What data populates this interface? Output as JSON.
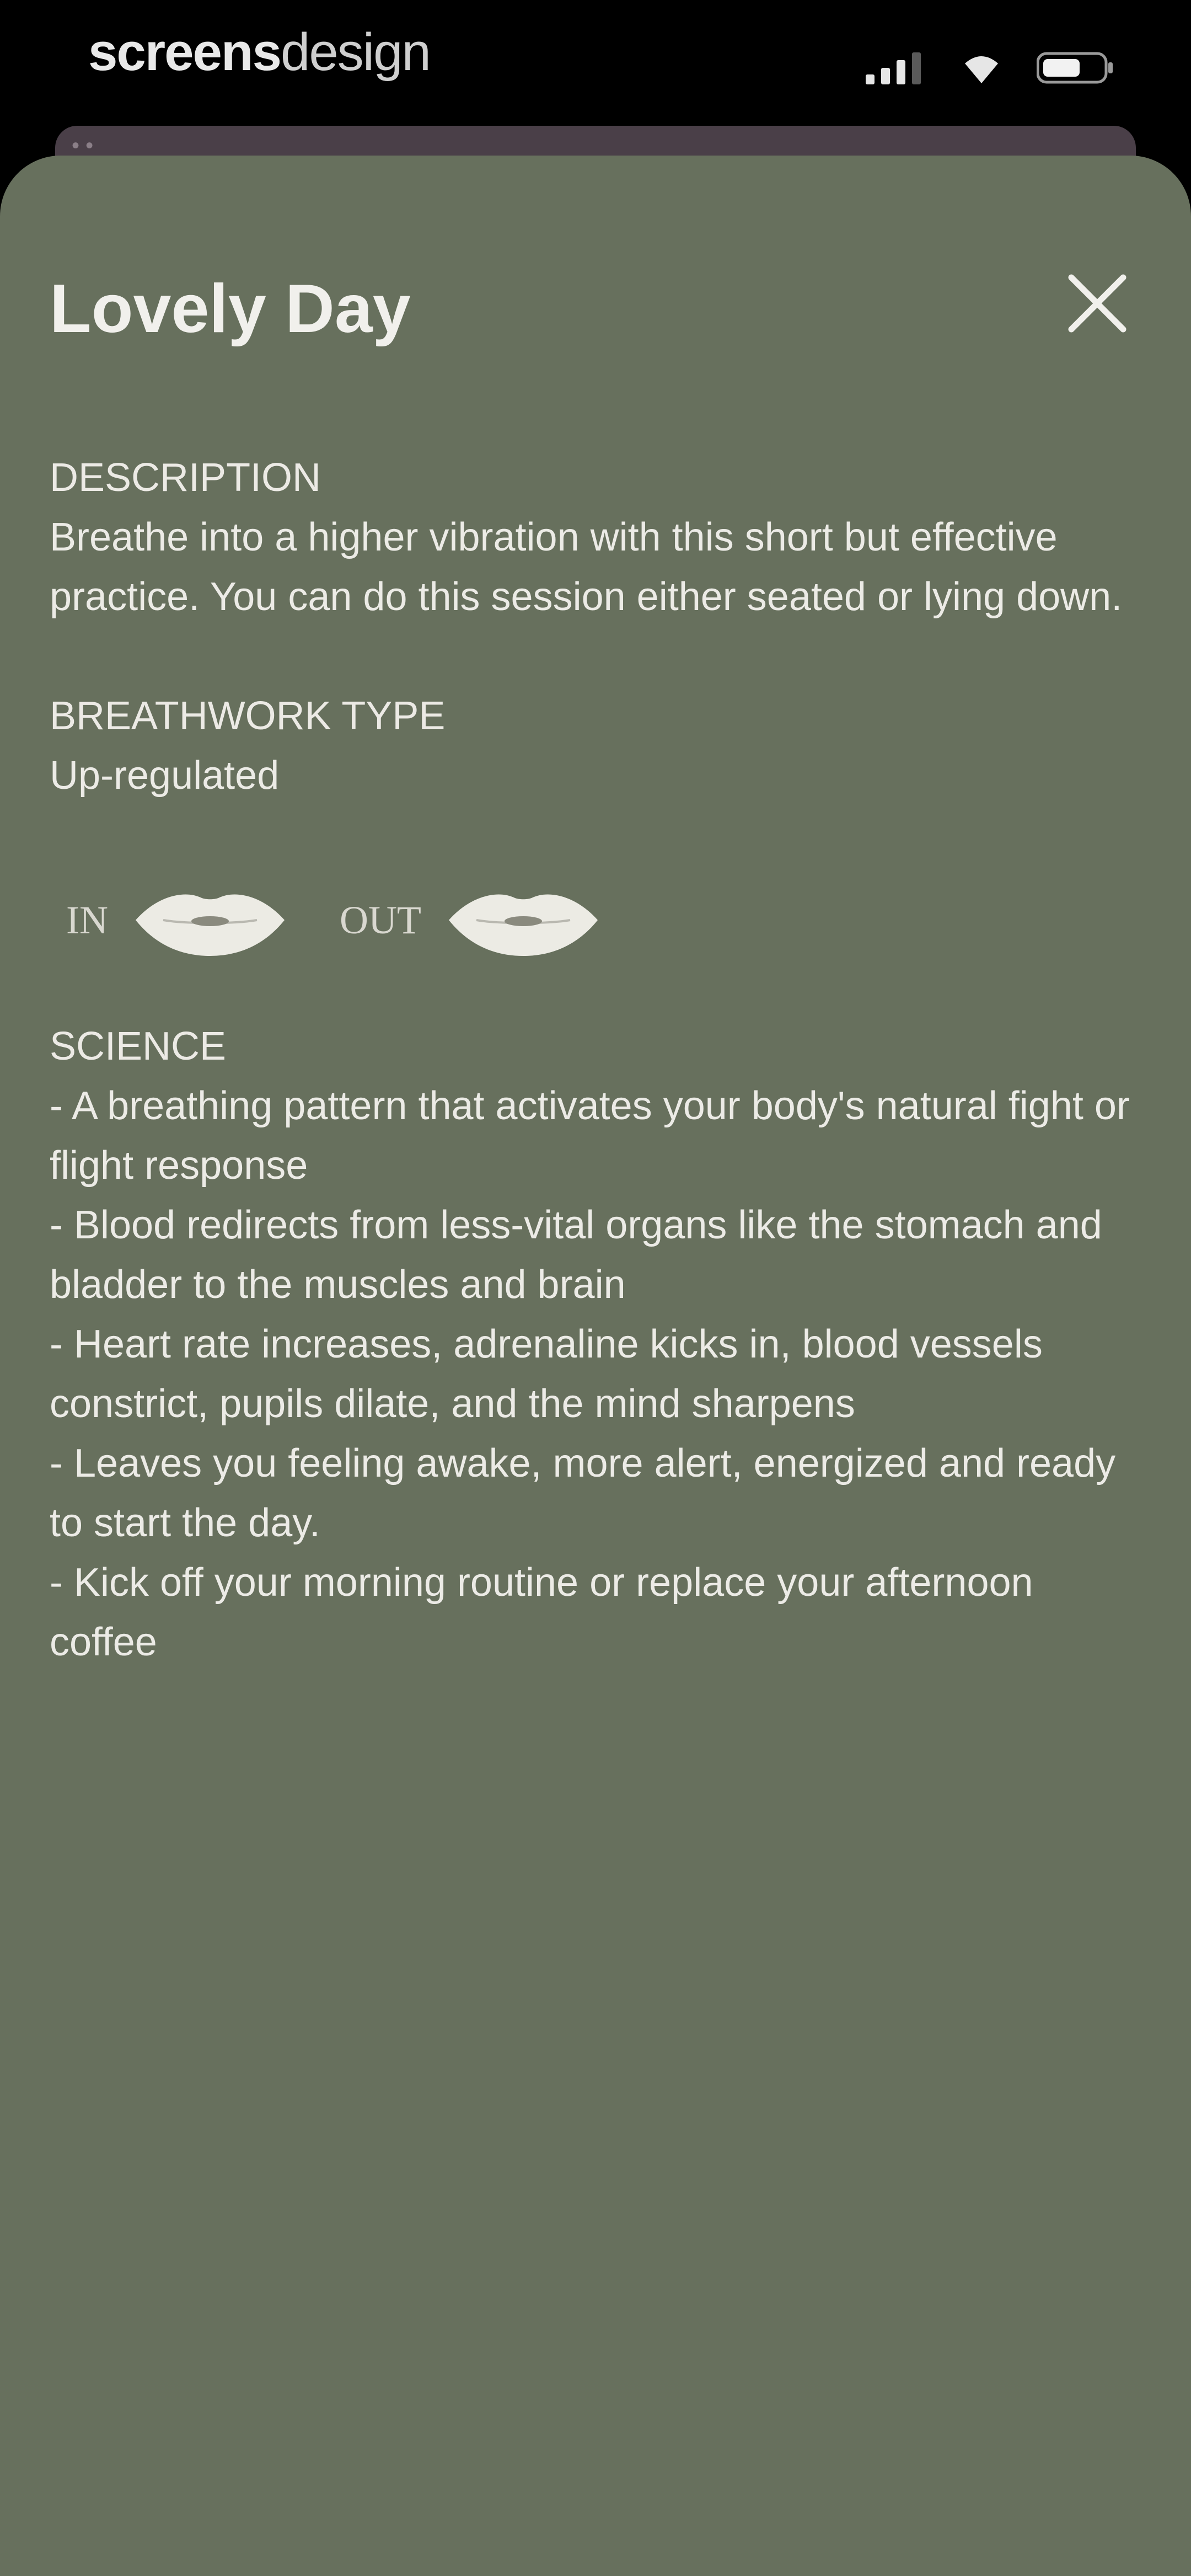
{
  "status_bar": {
    "brand_bold": "screens",
    "brand_light": "design",
    "icons": [
      "signal-icon",
      "wifi-icon",
      "battery-icon"
    ]
  },
  "sheet": {
    "title": "Lovely Day",
    "close_icon": "close-icon",
    "description": {
      "label": "DESCRIPTION",
      "text": "Breathe into a higher vibration with this short but effective practice. You can do this session either seated or lying down."
    },
    "breathwork": {
      "label": "BREATHWORK TYPE",
      "value": "Up-regulated"
    },
    "breath_pattern": {
      "in_label": "IN",
      "in_icon": "mouth-icon",
      "out_label": "OUT",
      "out_icon": "mouth-icon"
    },
    "science": {
      "label": "SCIENCE",
      "items": [
        "- A breathing pattern that activates your body's natural fight or flight response",
        "- Blood redirects from less-vital organs like the stomach and bladder to the muscles and brain",
        "- Heart rate increases, adrenaline kicks in, blood vessels constrict, pupils dilate, and the mind sharpens",
        "- Leaves you feeling awake, more alert, energized and ready to start the day.",
        "- Kick off your morning routine or replace your afternoon coffee"
      ]
    }
  },
  "colors": {
    "sheet_background": "#67705d",
    "text": "#ecebe6",
    "status_background": "#000000",
    "underlay": "#4a3f48"
  }
}
